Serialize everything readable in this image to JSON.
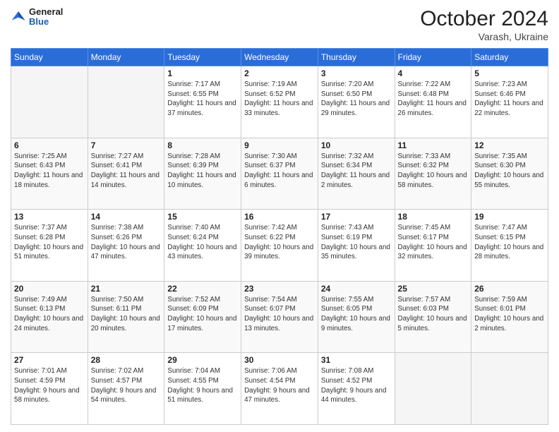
{
  "logo": {
    "general": "General",
    "blue": "Blue"
  },
  "header": {
    "month": "October 2024",
    "location": "Varash, Ukraine"
  },
  "weekdays": [
    "Sunday",
    "Monday",
    "Tuesday",
    "Wednesday",
    "Thursday",
    "Friday",
    "Saturday"
  ],
  "weeks": [
    [
      {
        "day": "",
        "empty": true
      },
      {
        "day": "",
        "empty": true
      },
      {
        "day": "1",
        "info": "Sunrise: 7:17 AM\nSunset: 6:55 PM\nDaylight: 11 hours and 37 minutes."
      },
      {
        "day": "2",
        "info": "Sunrise: 7:19 AM\nSunset: 6:52 PM\nDaylight: 11 hours and 33 minutes."
      },
      {
        "day": "3",
        "info": "Sunrise: 7:20 AM\nSunset: 6:50 PM\nDaylight: 11 hours and 29 minutes."
      },
      {
        "day": "4",
        "info": "Sunrise: 7:22 AM\nSunset: 6:48 PM\nDaylight: 11 hours and 26 minutes."
      },
      {
        "day": "5",
        "info": "Sunrise: 7:23 AM\nSunset: 6:46 PM\nDaylight: 11 hours and 22 minutes."
      }
    ],
    [
      {
        "day": "6",
        "info": "Sunrise: 7:25 AM\nSunset: 6:43 PM\nDaylight: 11 hours and 18 minutes."
      },
      {
        "day": "7",
        "info": "Sunrise: 7:27 AM\nSunset: 6:41 PM\nDaylight: 11 hours and 14 minutes."
      },
      {
        "day": "8",
        "info": "Sunrise: 7:28 AM\nSunset: 6:39 PM\nDaylight: 11 hours and 10 minutes."
      },
      {
        "day": "9",
        "info": "Sunrise: 7:30 AM\nSunset: 6:37 PM\nDaylight: 11 hours and 6 minutes."
      },
      {
        "day": "10",
        "info": "Sunrise: 7:32 AM\nSunset: 6:34 PM\nDaylight: 11 hours and 2 minutes."
      },
      {
        "day": "11",
        "info": "Sunrise: 7:33 AM\nSunset: 6:32 PM\nDaylight: 10 hours and 58 minutes."
      },
      {
        "day": "12",
        "info": "Sunrise: 7:35 AM\nSunset: 6:30 PM\nDaylight: 10 hours and 55 minutes."
      }
    ],
    [
      {
        "day": "13",
        "info": "Sunrise: 7:37 AM\nSunset: 6:28 PM\nDaylight: 10 hours and 51 minutes."
      },
      {
        "day": "14",
        "info": "Sunrise: 7:38 AM\nSunset: 6:26 PM\nDaylight: 10 hours and 47 minutes."
      },
      {
        "day": "15",
        "info": "Sunrise: 7:40 AM\nSunset: 6:24 PM\nDaylight: 10 hours and 43 minutes."
      },
      {
        "day": "16",
        "info": "Sunrise: 7:42 AM\nSunset: 6:22 PM\nDaylight: 10 hours and 39 minutes."
      },
      {
        "day": "17",
        "info": "Sunrise: 7:43 AM\nSunset: 6:19 PM\nDaylight: 10 hours and 35 minutes."
      },
      {
        "day": "18",
        "info": "Sunrise: 7:45 AM\nSunset: 6:17 PM\nDaylight: 10 hours and 32 minutes."
      },
      {
        "day": "19",
        "info": "Sunrise: 7:47 AM\nSunset: 6:15 PM\nDaylight: 10 hours and 28 minutes."
      }
    ],
    [
      {
        "day": "20",
        "info": "Sunrise: 7:49 AM\nSunset: 6:13 PM\nDaylight: 10 hours and 24 minutes."
      },
      {
        "day": "21",
        "info": "Sunrise: 7:50 AM\nSunset: 6:11 PM\nDaylight: 10 hours and 20 minutes."
      },
      {
        "day": "22",
        "info": "Sunrise: 7:52 AM\nSunset: 6:09 PM\nDaylight: 10 hours and 17 minutes."
      },
      {
        "day": "23",
        "info": "Sunrise: 7:54 AM\nSunset: 6:07 PM\nDaylight: 10 hours and 13 minutes."
      },
      {
        "day": "24",
        "info": "Sunrise: 7:55 AM\nSunset: 6:05 PM\nDaylight: 10 hours and 9 minutes."
      },
      {
        "day": "25",
        "info": "Sunrise: 7:57 AM\nSunset: 6:03 PM\nDaylight: 10 hours and 5 minutes."
      },
      {
        "day": "26",
        "info": "Sunrise: 7:59 AM\nSunset: 6:01 PM\nDaylight: 10 hours and 2 minutes."
      }
    ],
    [
      {
        "day": "27",
        "info": "Sunrise: 7:01 AM\nSunset: 4:59 PM\nDaylight: 9 hours and 58 minutes."
      },
      {
        "day": "28",
        "info": "Sunrise: 7:02 AM\nSunset: 4:57 PM\nDaylight: 9 hours and 54 minutes."
      },
      {
        "day": "29",
        "info": "Sunrise: 7:04 AM\nSunset: 4:55 PM\nDaylight: 9 hours and 51 minutes."
      },
      {
        "day": "30",
        "info": "Sunrise: 7:06 AM\nSunset: 4:54 PM\nDaylight: 9 hours and 47 minutes."
      },
      {
        "day": "31",
        "info": "Sunrise: 7:08 AM\nSunset: 4:52 PM\nDaylight: 9 hours and 44 minutes."
      },
      {
        "day": "",
        "empty": true
      },
      {
        "day": "",
        "empty": true
      }
    ]
  ]
}
